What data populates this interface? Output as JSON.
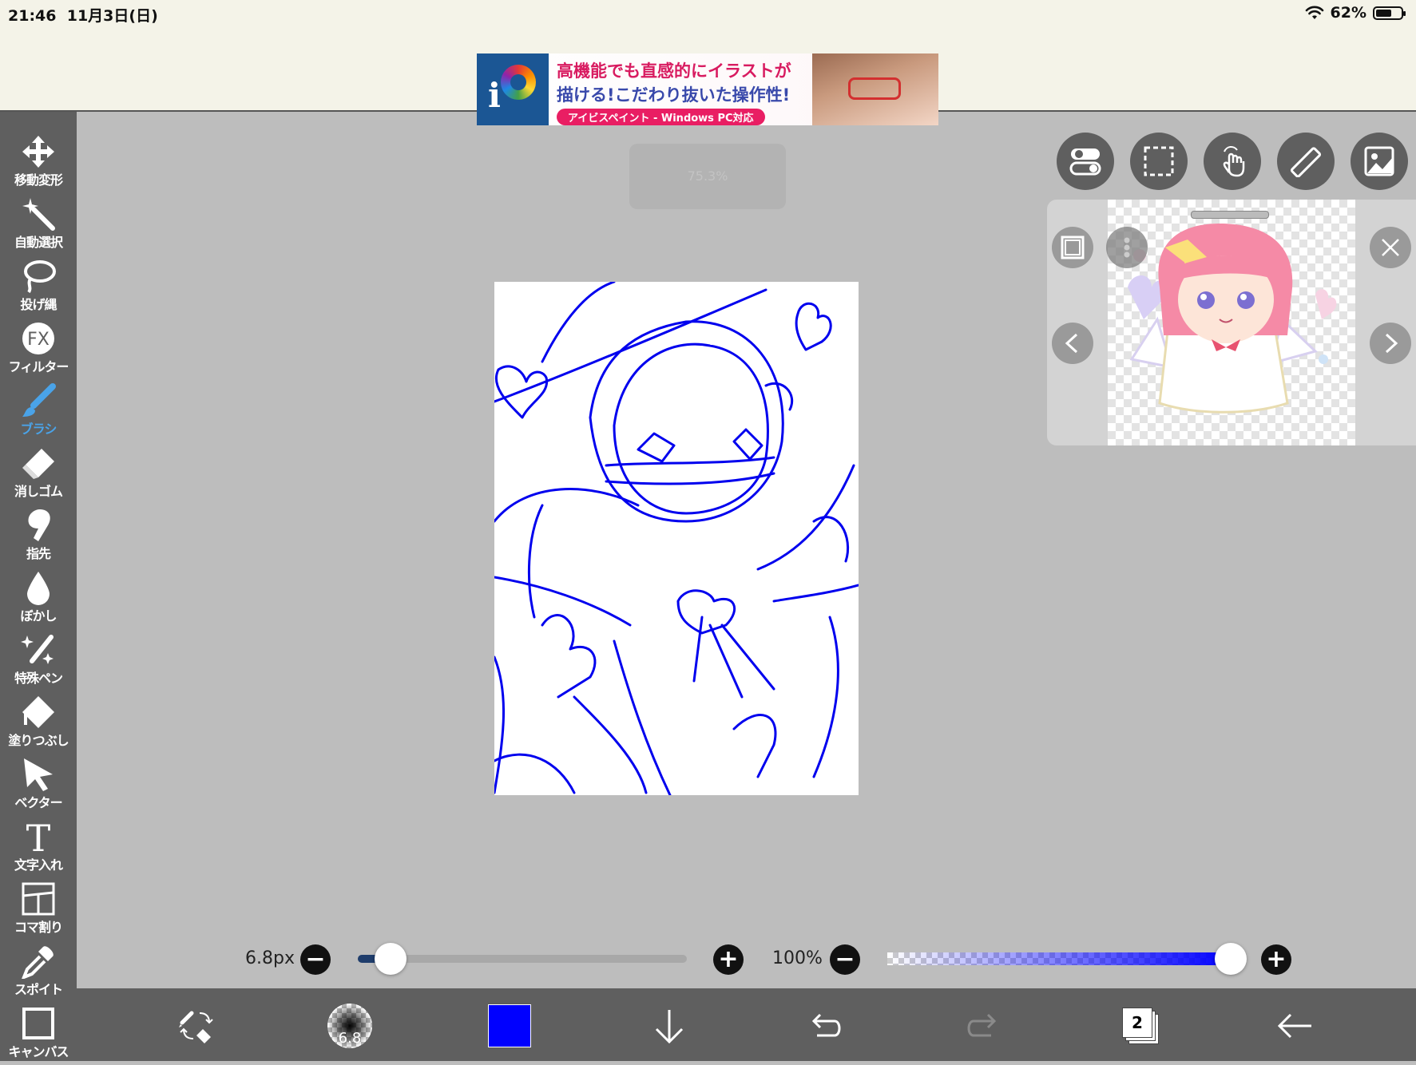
{
  "status": {
    "time": "21:46",
    "date": "11月3日(日)",
    "battery": "62%",
    "battery_level": 0.62
  },
  "ad": {
    "line1": "高機能でも直感的にイラストが",
    "line2": "描ける!こだわり抜いた操作性!",
    "tag": "アイビスペイント - Windows PC対応"
  },
  "tools": [
    {
      "id": "move",
      "label": "移動変形",
      "icon": "move-icon"
    },
    {
      "id": "magic-wand",
      "label": "自動選択",
      "icon": "magic-wand-icon"
    },
    {
      "id": "lasso",
      "label": "投げ縄",
      "icon": "lasso-icon"
    },
    {
      "id": "filter",
      "label": "フィルター",
      "icon": "fx-icon"
    },
    {
      "id": "brush",
      "label": "ブラシ",
      "icon": "brush-icon",
      "active": true
    },
    {
      "id": "eraser",
      "label": "消しゴム",
      "icon": "eraser-icon"
    },
    {
      "id": "smudge",
      "label": "指先",
      "icon": "smudge-icon"
    },
    {
      "id": "blur",
      "label": "ぼかし",
      "icon": "blur-drop-icon"
    },
    {
      "id": "special-pen",
      "label": "特殊ペン",
      "icon": "special-pen-icon"
    },
    {
      "id": "fill",
      "label": "塗りつぶし",
      "icon": "fill-bucket-icon"
    },
    {
      "id": "vector",
      "label": "ベクター",
      "icon": "cursor-arrow-icon"
    },
    {
      "id": "text",
      "label": "文字入れ",
      "icon": "text-t-icon"
    },
    {
      "id": "frame",
      "label": "コマ割り",
      "icon": "frame-divider-icon"
    },
    {
      "id": "eyedropper",
      "label": "スポイト",
      "icon": "eyedropper-icon"
    },
    {
      "id": "canvas",
      "label": "キャンバス",
      "icon": "canvas-icon"
    }
  ],
  "floating_toolbar": [
    {
      "id": "toggle",
      "icon": "toggle-switch-icon"
    },
    {
      "id": "selection",
      "icon": "selection-rect-icon"
    },
    {
      "id": "touch",
      "icon": "touch-hand-icon"
    },
    {
      "id": "ruler",
      "icon": "ruler-icon"
    },
    {
      "id": "reference",
      "icon": "reference-image-icon"
    }
  ],
  "ghost_label": "75.3%",
  "brush_size": {
    "label": "6.8px",
    "value": 6.8,
    "level": 0.1
  },
  "opacity": {
    "label": "100%",
    "value": 100
  },
  "bottom": {
    "brush_preview_value": "6.8",
    "layer_count": "2"
  },
  "colors": {
    "primary": "#0000ff",
    "toolbar": "#5f5f5f",
    "canvas_bg": "#bdbdbd",
    "active_tool": "#4aa3e8"
  }
}
